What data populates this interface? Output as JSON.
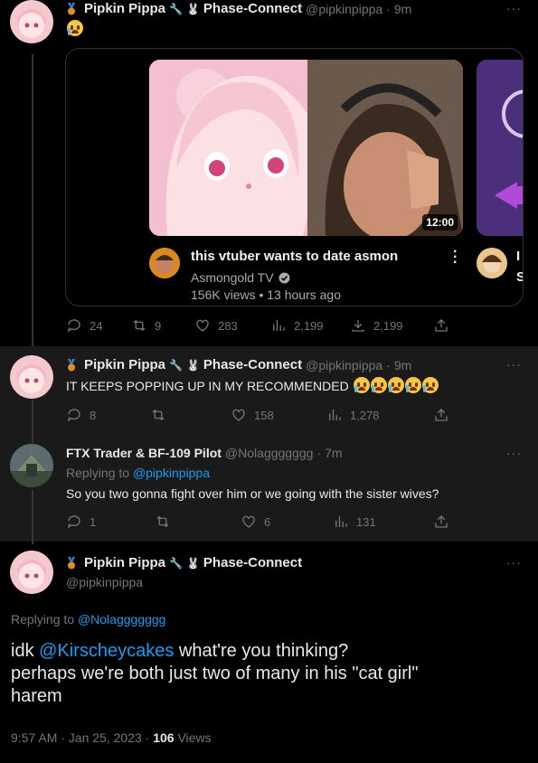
{
  "user": {
    "display_name": "Pipkin Pippa",
    "affiliation": "Phase-Connect",
    "handle": "@pipkinpippa"
  },
  "tweet1": {
    "time": "9m",
    "card": {
      "duration": "12:00",
      "title": "this vtuber wants to date asmon",
      "channel": "Asmongold TV",
      "meta": "156K views • 13 hours ago",
      "side_letter_1": "I",
      "side_letter_2": "S"
    },
    "actions": {
      "replies": "24",
      "retweets": "9",
      "likes": "283",
      "views": "2,199",
      "bookmarks": "2,199"
    }
  },
  "tweet2": {
    "time": "9m",
    "text": "IT KEEPS POPPING UP IN MY RECOMMENDED",
    "actions": {
      "replies": "8",
      "retweets": "",
      "likes": "158",
      "views": "1,278"
    }
  },
  "tweet3": {
    "name": "FTX Trader & BF-109 Pilot",
    "handle": "@Nolaggggggg",
    "time": "7m",
    "replying_prefix": "Replying to",
    "replying_to": "@pipkinpippa",
    "text": "So you two gonna fight over him or we going with the sister wives?",
    "actions": {
      "replies": "1",
      "retweets": "",
      "likes": "6",
      "views": "131"
    }
  },
  "main_tweet": {
    "replying_prefix": "Replying to",
    "replying_to": "@Nolaggggggg",
    "text_pre": "idk ",
    "mention": "@Kirscheycakes",
    "text_post": " what're you thinking?",
    "line2": "perhaps we're both just two of many in his \"cat girl\"",
    "line3": "harem",
    "time": "9:57 AM · Jan 25, 2023 ·",
    "view_count": "106",
    "view_label": "Views"
  },
  "separator": "·",
  "more_glyph": "···",
  "colors": {
    "bg": "#000000",
    "text": "#e7e9ea",
    "muted": "#71767b",
    "link": "#1d9bf0"
  }
}
